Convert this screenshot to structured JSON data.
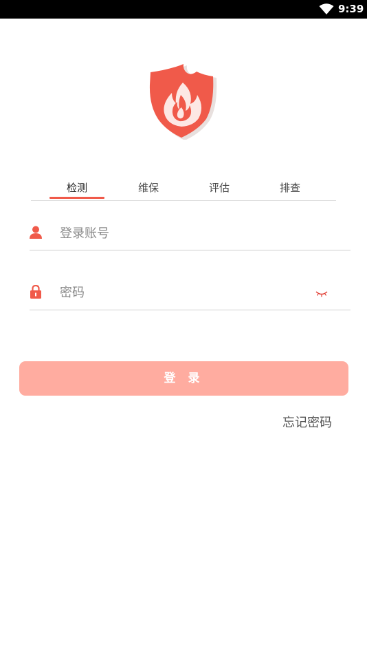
{
  "status_bar": {
    "time": "9:39",
    "icons": [
      "wifi-icon"
    ]
  },
  "logo": {
    "icon": "fire-shield-logo",
    "color": "#f05a4a"
  },
  "tabs": [
    {
      "label": "检测",
      "active": true
    },
    {
      "label": "维保",
      "active": false
    },
    {
      "label": "评估",
      "active": false
    },
    {
      "label": "排查",
      "active": false
    }
  ],
  "form": {
    "account": {
      "placeholder": "登录账号",
      "value": "",
      "icon": "user-icon"
    },
    "password": {
      "placeholder": "密码",
      "value": "",
      "icon": "lock-icon",
      "toggle_icon": "eye-closed-icon"
    }
  },
  "login_button": {
    "label": "登 录"
  },
  "forgot_link": {
    "label": "忘记密码"
  },
  "colors": {
    "accent": "#f05a4a",
    "button": "#ffaca0",
    "divider": "#cfcfcf"
  }
}
